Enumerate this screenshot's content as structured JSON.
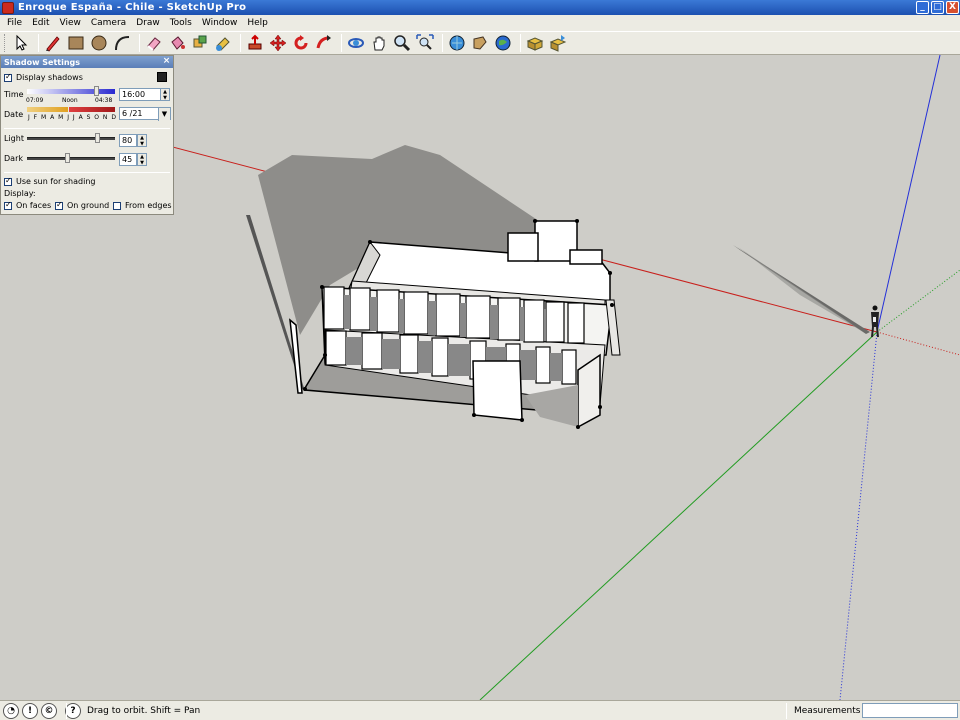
{
  "window": {
    "title": "Enroque España - Chile - SketchUp Pro",
    "buttons": [
      "_",
      "□",
      "X"
    ]
  },
  "menu": [
    "File",
    "Edit",
    "View",
    "Camera",
    "Draw",
    "Tools",
    "Window",
    "Help"
  ],
  "toolbar": {
    "tools": [
      {
        "name": "select-tool-icon"
      },
      {
        "name": "pencil-line-tool-icon"
      },
      {
        "name": "rectangle-tool-icon"
      },
      {
        "name": "circle-tool-icon"
      },
      {
        "name": "arc-tool-icon"
      },
      {
        "name": "eraser-tool-icon"
      },
      {
        "name": "paint-bucket-tool-icon"
      },
      {
        "name": "make-component-icon"
      },
      {
        "name": "paint-tool-icon"
      },
      {
        "name": "push-pull-tool-icon"
      },
      {
        "name": "move-tool-icon"
      },
      {
        "name": "rotate-tool-icon"
      },
      {
        "name": "follow-me-tool-icon"
      },
      {
        "name": "orbit-tool-icon"
      },
      {
        "name": "pan-tool-icon"
      },
      {
        "name": "zoom-tool-icon"
      },
      {
        "name": "zoom-extents-icon"
      },
      {
        "name": "get-models-icon"
      },
      {
        "name": "share-model-icon"
      },
      {
        "name": "google-earth-icon"
      },
      {
        "name": "component-icon"
      },
      {
        "name": "share-component-icon"
      }
    ]
  },
  "shadow_panel": {
    "title": "Shadow Settings",
    "close": "×",
    "display_shadows": {
      "label": "Display shadows",
      "checked": true
    },
    "time": {
      "label": "Time",
      "start": "07:09",
      "noon": "Noon",
      "end": "04:38",
      "value": "16:00",
      "level": 0.78
    },
    "date": {
      "label": "Date",
      "months": "J F M A M J J A S O N D",
      "value": "6 /21"
    },
    "light": {
      "label": "Light",
      "value": "80",
      "level": 0.8
    },
    "dark": {
      "label": "Dark",
      "value": "45",
      "level": 0.45
    },
    "use_sun": {
      "label": "Use sun for shading",
      "checked": true
    },
    "display_label": "Display:",
    "on_faces": {
      "label": "On faces",
      "checked": true
    },
    "on_ground": {
      "label": "On ground",
      "checked": true
    },
    "from_edges": {
      "label": "From edges",
      "checked": false
    }
  },
  "status": {
    "hint": "Drag to orbit.  Shift = Pan",
    "measurements_label": "Measurements",
    "measurements_value": ""
  },
  "colors": {
    "viewport": "#cecdc8",
    "shadow": "#8e8d8a",
    "red_axis": "#c8201c",
    "green_axis": "#229c22",
    "blue_axis": "#2430d8",
    "title_bar": "#2559c4"
  }
}
